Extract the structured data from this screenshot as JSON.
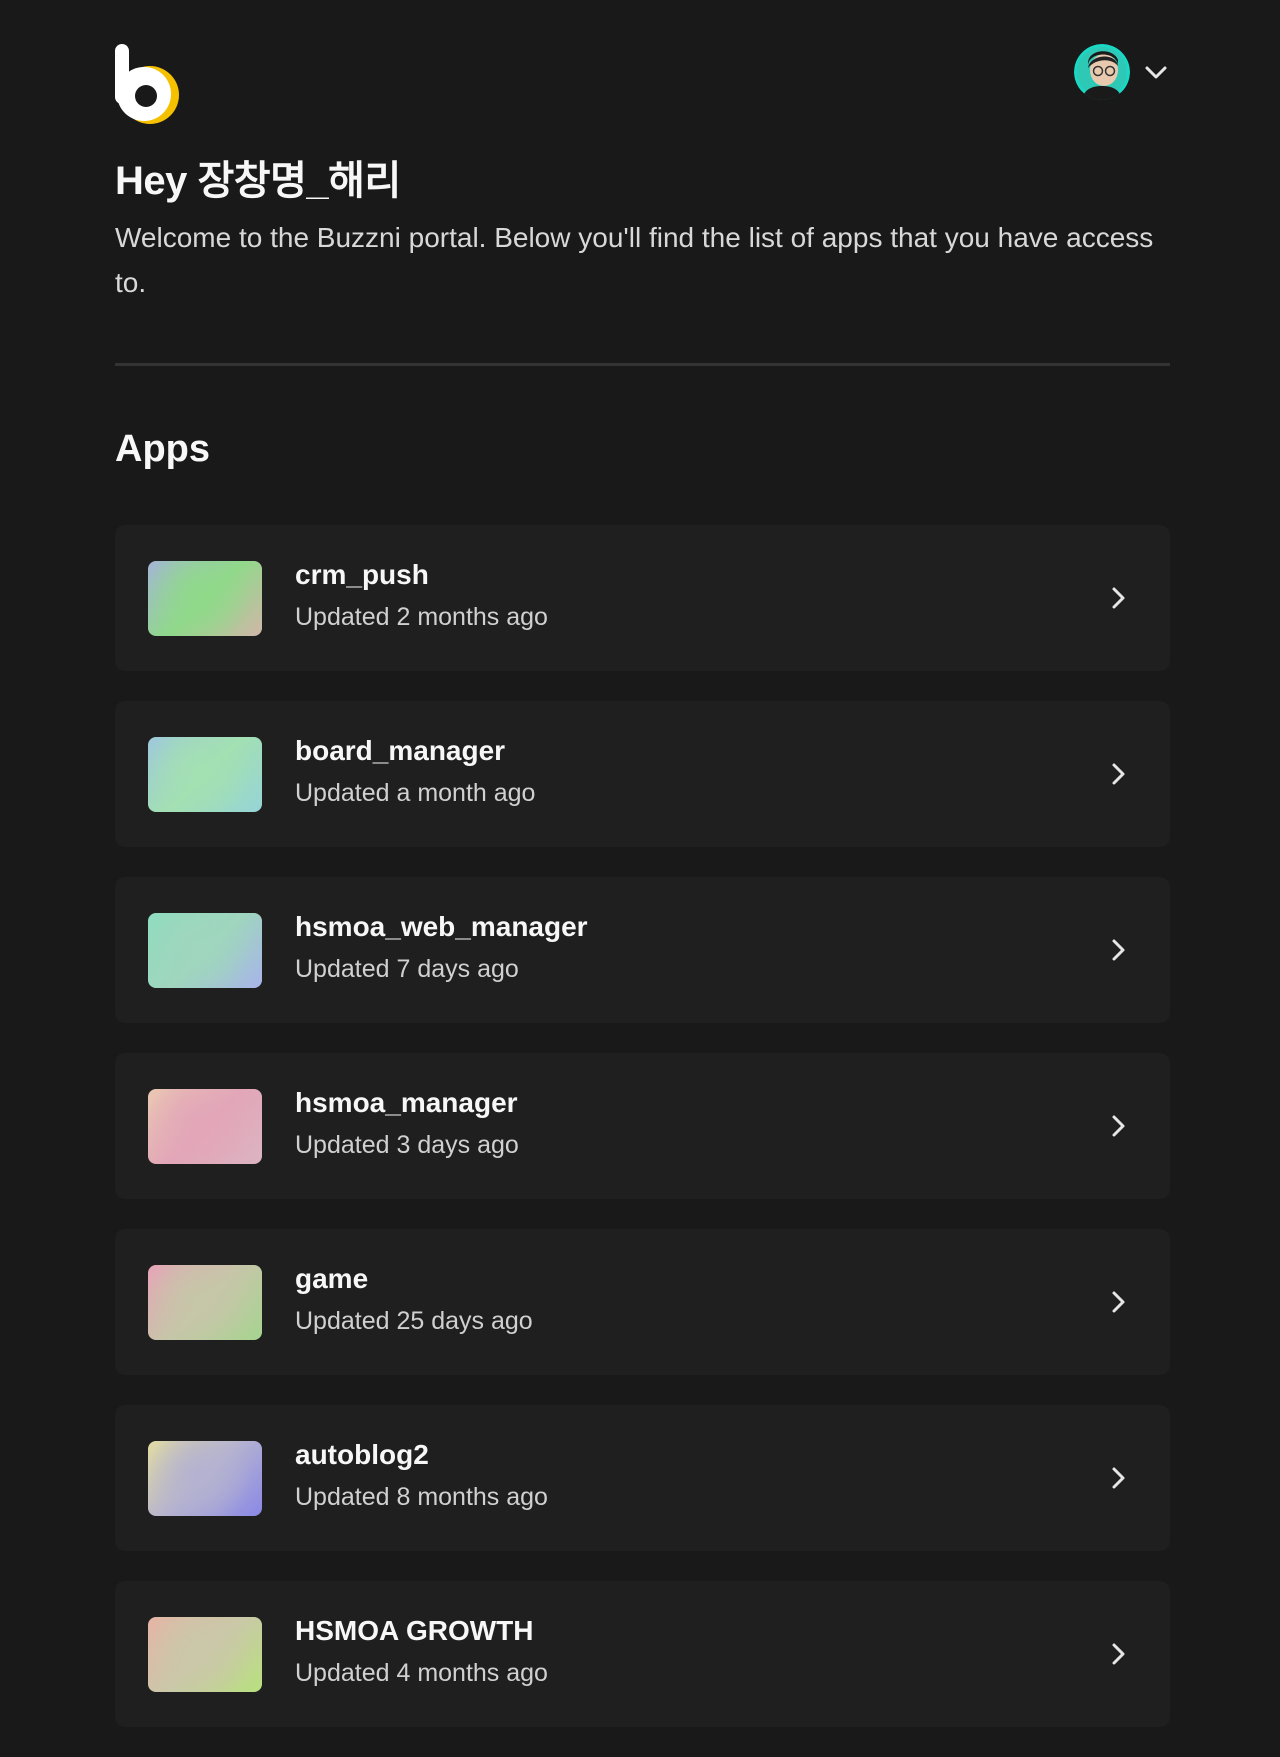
{
  "header": {
    "logo_icon": "buzzni-b-logo-icon",
    "brand_colors": {
      "logo_white": "#ffffff",
      "logo_yellow": "#f5c000"
    },
    "user_avatar_icon": "user-avatar",
    "user_menu_icon": "chevron-down-icon"
  },
  "hero": {
    "greeting": "Hey 장창명_해리",
    "subtitle": "Welcome to the Buzzni portal. Below you'll find the list of apps that you have access to."
  },
  "apps_section": {
    "title": "Apps",
    "items": [
      {
        "name": "crm_push",
        "updated": "Updated 2 months ago",
        "thumb": [
          "#a4b5d6",
          "#90d98a",
          "#d0b6a8"
        ]
      },
      {
        "name": "board_manager",
        "updated": "Updated a month ago",
        "thumb": [
          "#9ec8dc",
          "#a3e0b2",
          "#96d4d8"
        ]
      },
      {
        "name": "hsmoa_web_manager",
        "updated": "Updated 7 days ago",
        "thumb": [
          "#8fdcc0",
          "#9fd6bd",
          "#a8b4ea"
        ]
      },
      {
        "name": "hsmoa_manager",
        "updated": "Updated 3 days ago",
        "thumb": [
          "#eac8b2",
          "#e2a6b8",
          "#dcb4c2"
        ]
      },
      {
        "name": "game",
        "updated": "Updated 25 days ago",
        "thumb": [
          "#e7a4b8",
          "#c6c6a8",
          "#a6d490"
        ]
      },
      {
        "name": "autoblog2",
        "updated": "Updated 8 months ago",
        "thumb": [
          "#e2dca2",
          "#b4b2d0",
          "#8a88e6"
        ]
      },
      {
        "name": "HSMOA GROWTH",
        "updated": "Updated 4 months ago",
        "thumb": [
          "#e6b4a6",
          "#cac8a8",
          "#b8e07e"
        ]
      }
    ],
    "item_action_icon": "chevron-right-icon"
  },
  "colors": {
    "background": "#191919",
    "card": "#1f1f1f",
    "divider": "#333333",
    "text_primary": "#f7f7f7",
    "text_secondary": "#d0d0d0"
  }
}
